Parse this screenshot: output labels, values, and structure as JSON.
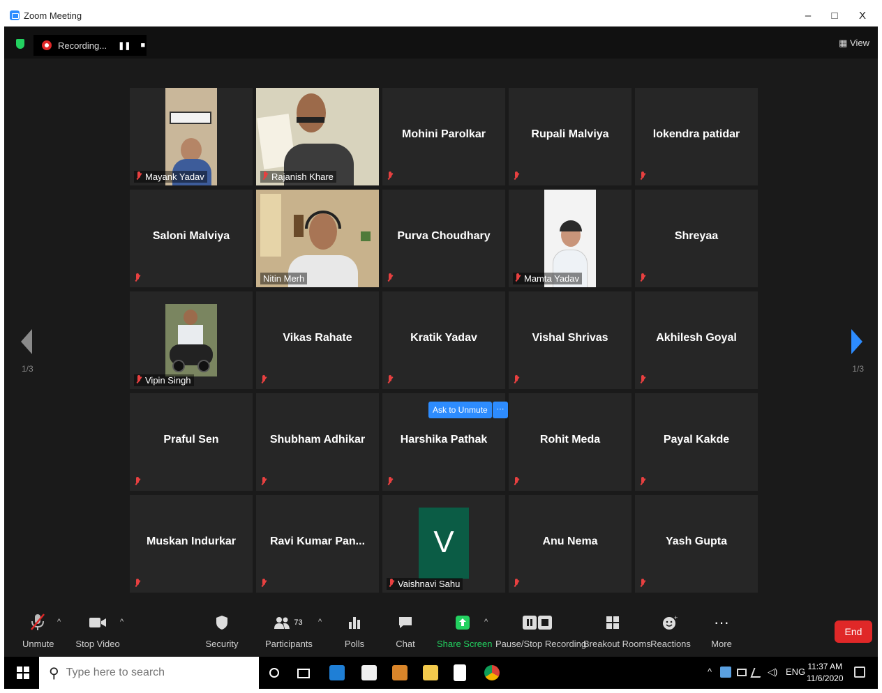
{
  "window": {
    "title": "Zoom Meeting",
    "minimize": "–",
    "maximize": "□",
    "close": "X"
  },
  "topbar": {
    "recording_label": "Recording...",
    "pause_glyph": "❚❚",
    "stop_glyph": "■",
    "view_label": "View",
    "view_glyph": "▦"
  },
  "grid": {
    "tiles": [
      {
        "name": "Mayank Yadav",
        "kind": "video"
      },
      {
        "name": "Rajanish Khare",
        "kind": "video"
      },
      {
        "name": "Mohini Parolkar",
        "kind": "name"
      },
      {
        "name": "Rupali Malviya",
        "kind": "name"
      },
      {
        "name": "lokendra patidar",
        "kind": "name"
      },
      {
        "name": "Saloni Malviya",
        "kind": "name"
      },
      {
        "name": "Nitin Merh",
        "kind": "video",
        "active_speaker": true
      },
      {
        "name": "Purva Choudhary",
        "kind": "name"
      },
      {
        "name": "Mamta Yadav",
        "kind": "video"
      },
      {
        "name": "Shreyaa",
        "kind": "name"
      },
      {
        "name": "Vipin Singh",
        "kind": "video"
      },
      {
        "name": "Vikas Rahate",
        "kind": "name"
      },
      {
        "name": "Kratik Yadav",
        "kind": "name"
      },
      {
        "name": "Vishal Shrivas",
        "kind": "name"
      },
      {
        "name": "Akhilesh Goyal",
        "kind": "name"
      },
      {
        "name": "Praful Sen",
        "kind": "name"
      },
      {
        "name": "Shubham Adhikar",
        "kind": "name"
      },
      {
        "name": "Harshika Pathak",
        "kind": "name"
      },
      {
        "name": "Rohit Meda",
        "kind": "name"
      },
      {
        "name": "Payal Kakde",
        "kind": "name"
      },
      {
        "name": "Muskan Indurkar",
        "kind": "name"
      },
      {
        "name": "Ravi Kumar Pan...",
        "kind": "name"
      },
      {
        "name": "Vaishnavi Sahu",
        "kind": "avatar",
        "initial": "V"
      },
      {
        "name": "Anu Nema",
        "kind": "name"
      },
      {
        "name": "Yash Gupta",
        "kind": "name"
      }
    ],
    "ask_to_unmute": "Ask to Unmute",
    "more_glyph": "···",
    "page_left": "1/3",
    "page_right": "1/3"
  },
  "toolbar": {
    "unmute": "Unmute",
    "stop_video": "Stop Video",
    "security": "Security",
    "participants": "Participants",
    "participants_count": "73",
    "polls": "Polls",
    "chat": "Chat",
    "share_screen": "Share Screen",
    "pause_stop_recording": "Pause/Stop Recording",
    "breakout_rooms": "Breakout Rooms",
    "reactions": "Reactions",
    "more": "More",
    "more_glyph": "···",
    "caret": "^",
    "end": "End"
  },
  "taskbar": {
    "search_placeholder": "Type here to search",
    "tray_caret": "^",
    "language": "ENG",
    "time": "11:37 AM",
    "date": "11/6/2020"
  },
  "colors": {
    "accent": "#2d8cff",
    "end_red": "#e02828",
    "speaker_outline": "#c5d86d",
    "share_green": "#23d160",
    "avatar_green": "#0b5c45"
  }
}
